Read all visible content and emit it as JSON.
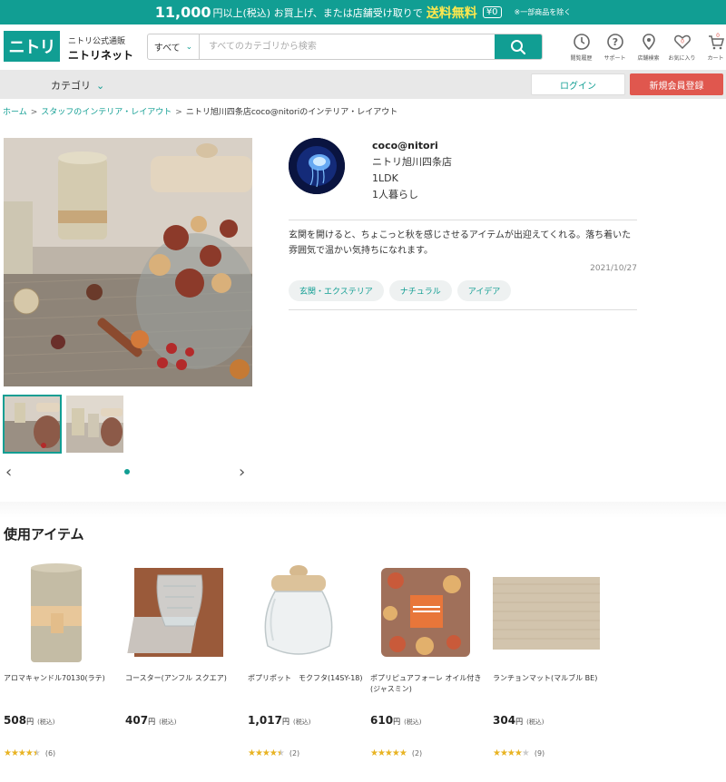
{
  "banner": {
    "amount": "11,000",
    "text": "円以上(税込) お買上げ、または店舗受け取りで",
    "free": "送料無料",
    "zero": "¥0",
    "note": "※一部商品を除く"
  },
  "header": {
    "logo": "ニトリ",
    "brand_sub": "ニトリ公式通販",
    "brand_main": "ニトリネット",
    "search_scope": "すべて",
    "search_placeholder": "すべてのカテゴリから検索",
    "icons": [
      {
        "label": "閲覧履歴",
        "icon": "history-icon"
      },
      {
        "label": "サポート",
        "icon": "help-icon"
      },
      {
        "label": "店舗検索",
        "icon": "location-pin-icon"
      },
      {
        "label": "お気に入り",
        "icon": "heart-icon",
        "badge": "0"
      },
      {
        "label": "カート",
        "icon": "cart-icon",
        "badge": "0"
      }
    ]
  },
  "nav": {
    "category": "カテゴリ",
    "login": "ログイン",
    "signup": "新規会員登録"
  },
  "breadcrumb": {
    "items": [
      "ホーム",
      "スタッフのインテリア・レイアウト"
    ],
    "current": "ニトリ旭川四条店coco@nitoriのインテリア・レイアウト",
    "sep": ">"
  },
  "profile": {
    "name": "coco@nitori",
    "store": "ニトリ旭川四条店",
    "layout": "1LDK",
    "household": "1人暮らし"
  },
  "post": {
    "description": "玄関を開けると、ちょこっと秋を感じさせるアイテムが出迎えてくれる。落ち着いた雰囲気で温かい気持ちになれます。",
    "date": "2021/10/27",
    "tags": [
      "玄関・エクステリア",
      "ナチュラル",
      "アイデア"
    ]
  },
  "gallery": {
    "prev": "‹",
    "next": "›"
  },
  "section": {
    "title": "使用アイテム"
  },
  "products": [
    {
      "name": "アロマキャンドル70130(ラテ)",
      "price": "508",
      "yen": "円",
      "tax": "(税込)",
      "stars": 4.5,
      "reviews": "(6)"
    },
    {
      "name": "コースター(アンフル スクエア)",
      "price": "407",
      "yen": "円",
      "tax": "(税込)",
      "stars": 0,
      "reviews": ""
    },
    {
      "name": "ポプリポット　モクフタ(14SY-18)",
      "price": "1,017",
      "yen": "円",
      "tax": "(税込)",
      "stars": 4.5,
      "reviews": "(2)"
    },
    {
      "name": "ポプリピュアフォーレ オイル付き(ジャスミン)",
      "price": "610",
      "yen": "円",
      "tax": "(税込)",
      "stars": 5,
      "reviews": "(2)"
    },
    {
      "name": "ランチョンマット(マルブル BE)",
      "price": "304",
      "yen": "円",
      "tax": "(税込)",
      "stars": 4,
      "reviews": "(9)"
    }
  ],
  "colors": {
    "brand": "#119e93",
    "signup": "#e0574e",
    "star": "#e8b322"
  }
}
